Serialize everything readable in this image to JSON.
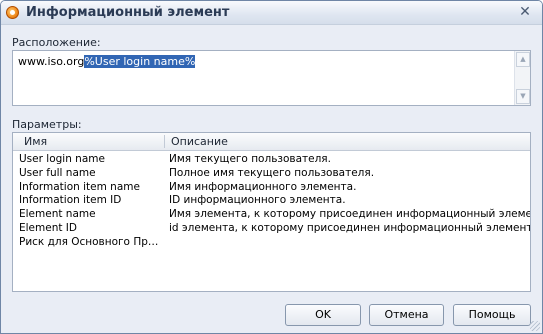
{
  "window": {
    "title": "Информационный элемент",
    "close_glyph": "✕",
    "accent_color": "#3166b4"
  },
  "location": {
    "label": "Расположение:",
    "value_prefix": "www.iso.org",
    "value_selected": "%User login name%"
  },
  "parameters": {
    "label": "Параметры:",
    "columns": [
      "Имя",
      "Описание"
    ],
    "rows": [
      {
        "name": "User login name",
        "description": "Имя текущего пользователя."
      },
      {
        "name": "User full name",
        "description": "Полное имя текущего пользователя."
      },
      {
        "name": "Information item name",
        "description": "Имя информационного элемента."
      },
      {
        "name": "Information item ID",
        "description": "ID информационного элемента."
      },
      {
        "name": "Element name",
        "description": "Имя элемента, к которому присоединен информационный элемент."
      },
      {
        "name": "Element ID",
        "description": "id элемента, к которому присоединен информационный элемент."
      },
      {
        "name": "Риск для Основного Проц…",
        "description": ""
      }
    ]
  },
  "buttons": {
    "ok": "OK",
    "cancel": "Отмена",
    "help": "Помощь"
  }
}
